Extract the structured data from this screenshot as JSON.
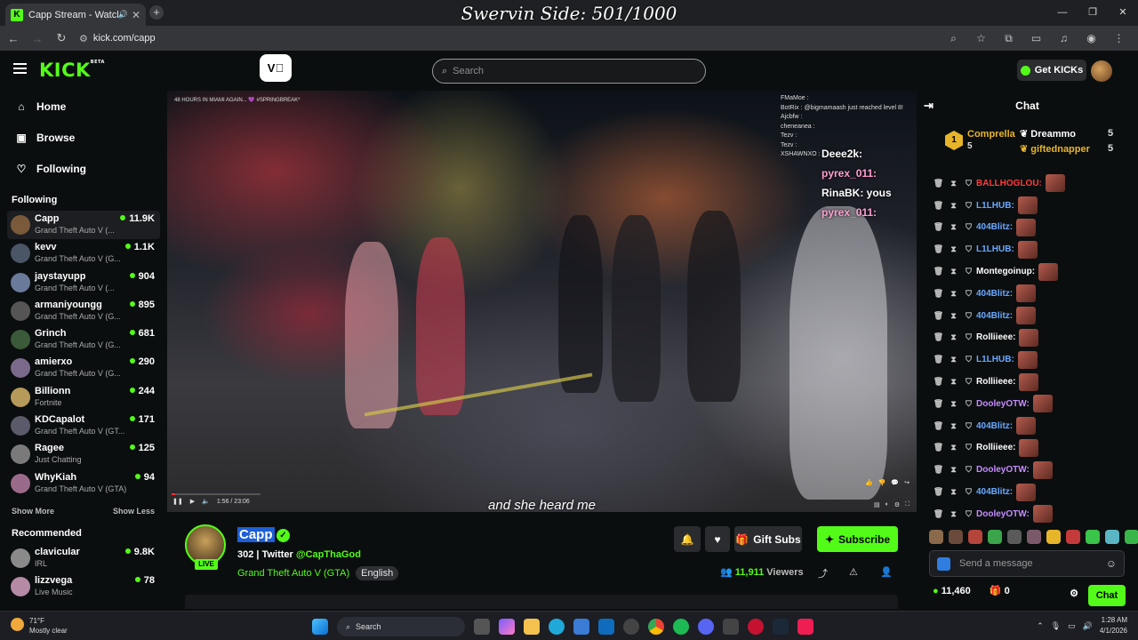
{
  "overlay": {
    "title": "Swervin Side: 501/1000"
  },
  "browser": {
    "tab_title": "Capp Stream - Watch Live o",
    "url": "kick.com/capp"
  },
  "header": {
    "logo": "KICK",
    "logo_sup": "BETA",
    "search_placeholder": "Search",
    "get_kicks": "Get KICKs",
    "ext_label": "V⃣"
  },
  "sidebar": {
    "nav": [
      {
        "label": "Home",
        "icon": "home-icon"
      },
      {
        "label": "Browse",
        "icon": "browse-icon"
      },
      {
        "label": "Following",
        "icon": "heart-icon"
      }
    ],
    "following_title": "Following",
    "following": [
      {
        "name": "Capp",
        "game": "Grand Theft Auto V (...",
        "viewers": "11.9K"
      },
      {
        "name": "kevv",
        "game": "Grand Theft Auto V (G...",
        "viewers": "1.1K"
      },
      {
        "name": "jaystayupp",
        "game": "Grand Theft Auto V (...",
        "viewers": "904"
      },
      {
        "name": "armaniyoungg",
        "game": "Grand Theft Auto V (G...",
        "viewers": "895"
      },
      {
        "name": "Grinch",
        "game": "Grand Theft Auto V (G...",
        "viewers": "681"
      },
      {
        "name": "amierxo",
        "game": "Grand Theft Auto V (G...",
        "viewers": "290"
      },
      {
        "name": "Billionn",
        "game": "Fortnite",
        "viewers": "244"
      },
      {
        "name": "KDCapalot",
        "game": "Grand Theft Auto V (GT...",
        "viewers": "171"
      },
      {
        "name": "Ragee",
        "game": "Just Chatting",
        "viewers": "125"
      },
      {
        "name": "WhyKiah",
        "game": "Grand Theft Auto V (GTA)",
        "viewers": "94"
      }
    ],
    "show_more": "Show More",
    "show_less": "Show Less",
    "recommended_title": "Recommended",
    "recommended": [
      {
        "name": "clavicular",
        "game": "IRL",
        "viewers": "9.8K"
      },
      {
        "name": "lizzvega",
        "game": "Live Music",
        "viewers": "78"
      }
    ]
  },
  "video": {
    "overlay_topleft": "48 HOURS IN MIAMI AGAIN... 💜 #SPRINGBREAK*",
    "subtitle": "and she heard me",
    "progress": 0.04,
    "time": "1:56 / 23:06",
    "overlay_chat_small": [
      "FMaMoe :",
      "BotRix : @bigmamaash just reached level 8!",
      "Ajcbfw :",
      "cheneanea :",
      "Tezv :",
      "Tezv :",
      "XSHAWNXO :"
    ],
    "overlay_chat_big": [
      {
        "name": "Deee2k:",
        "color": "#ffffff"
      },
      {
        "name": "pyrex_011:",
        "color": "#ff9ecf"
      },
      {
        "name": "RinaBK: yous",
        "color": "#ffffff"
      },
      {
        "name": "pyrex_011:",
        "color": "#ff9ecf"
      }
    ]
  },
  "stream": {
    "name": "Capp",
    "followers": "302",
    "twitter_label": "Twitter",
    "twitter_handle": "@CapThaGod",
    "category": "Grand Theft Auto V (GTA)",
    "language": "English",
    "live_label": "LIVE",
    "gift_subs": "Gift Subs",
    "subscribe": "Subscribe",
    "viewers_count": "11,911",
    "viewers_label": "Viewers"
  },
  "chat": {
    "title": "Chat",
    "leaders": [
      {
        "rank": "1",
        "name": "Comprella",
        "count": "5"
      },
      {
        "name": "Dreammo",
        "count": "5"
      },
      {
        "name": "giftednapper",
        "count": "5"
      }
    ],
    "messages": [
      {
        "user": "BALLHOGLOU:",
        "color": "#ff3b3b"
      },
      {
        "user": "L1LHUB:",
        "color": "#6aa8ff"
      },
      {
        "user": "404Blitz:",
        "color": "#6aa8ff"
      },
      {
        "user": "L1LHUB:",
        "color": "#6aa8ff"
      },
      {
        "user": "Montegoinup:",
        "color": "#ffffff"
      },
      {
        "user": "404Blitz:",
        "color": "#6aa8ff"
      },
      {
        "user": "404Blitz:",
        "color": "#6aa8ff"
      },
      {
        "user": "Rolliieee:",
        "color": "#ffffff"
      },
      {
        "user": "L1LHUB:",
        "color": "#6aa8ff"
      },
      {
        "user": "Rolliieee:",
        "color": "#ffffff"
      },
      {
        "user": "DooleyOTW:",
        "color": "#c58cff"
      },
      {
        "user": "404Blitz:",
        "color": "#6aa8ff"
      },
      {
        "user": "Rolliieee:",
        "color": "#ffffff"
      },
      {
        "user": "DooleyOTW:",
        "color": "#c58cff"
      },
      {
        "user": "404Blitz:",
        "color": "#6aa8ff"
      },
      {
        "user": "DooleyOTW:",
        "color": "#c58cff"
      }
    ],
    "send_placeholder": "Send a message",
    "kicks_balance": "11,460",
    "gifts_count": "0",
    "chat_button": "Chat"
  },
  "taskbar": {
    "temp": "71°F",
    "weather": "Mostly clear",
    "search": "Search",
    "time": "1:28 AM",
    "date": "4/1/2026"
  },
  "colors": {
    "accent": "#53fc18",
    "background": "#0b0e0f"
  }
}
